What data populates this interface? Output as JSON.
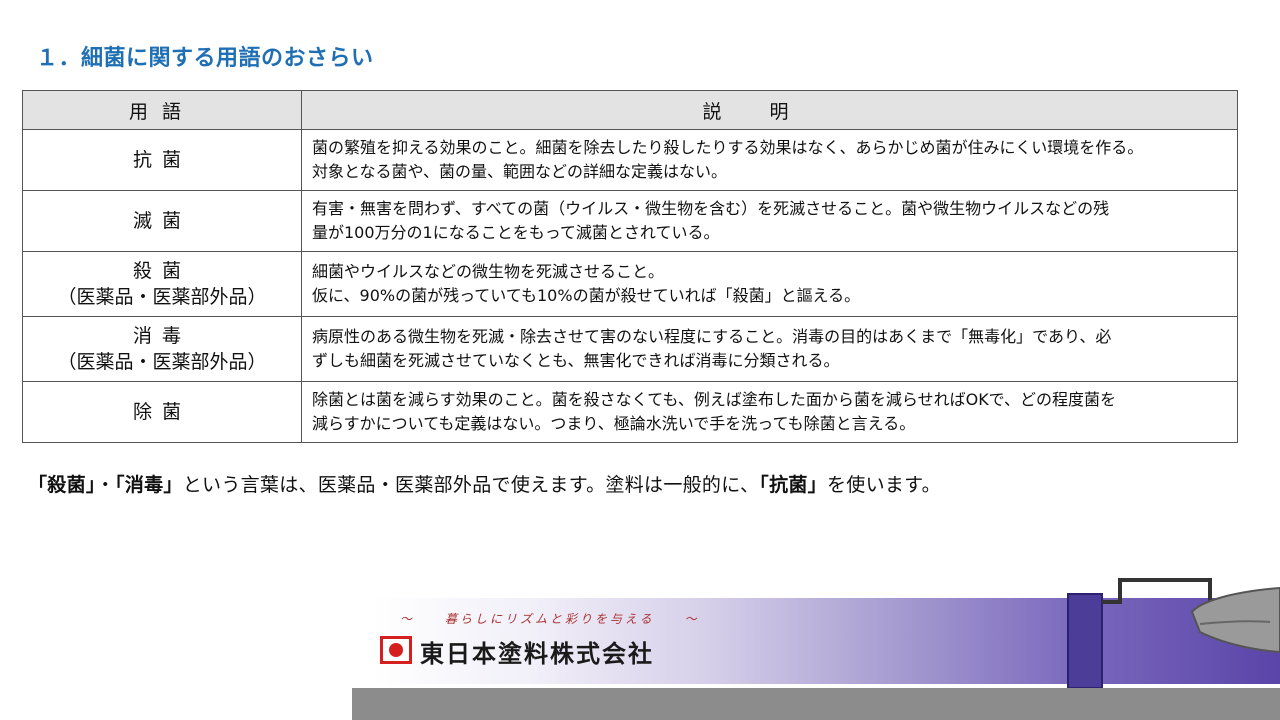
{
  "title": "１．細菌に関する用語のおさらい",
  "table": {
    "headers": {
      "term": "用語",
      "description": "説明"
    },
    "rows": [
      {
        "term": "抗菌",
        "term_sub": "",
        "desc": [
          "菌の繁殖を抑える効果のこと。細菌を除去したり殺したりする効果はなく、あらかじめ菌が住みにくい環境を作る。",
          "対象となる菌や、菌の量、範囲などの詳細な定義はない。"
        ]
      },
      {
        "term": "滅菌",
        "term_sub": "",
        "desc": [
          "有害・無害を問わず、すべての菌（ウイルス・微生物を含む）を死滅させること。菌や微生物ウイルスなどの残",
          "量が100万分の1になることをもって滅菌とされている。"
        ]
      },
      {
        "term": "殺菌",
        "term_sub": "（医薬品・医薬部外品）",
        "desc": [
          "細菌やウイルスなどの微生物を死滅させること。",
          "仮に、90%の菌が残っていても10%の菌が殺せていれば「殺菌」と謳える。"
        ]
      },
      {
        "term": "消毒",
        "term_sub": "（医薬品・医薬部外品）",
        "desc": [
          "病原性のある微生物を死滅・除去させて害のない程度にすること。消毒の目的はあくまで「無毒化」であり、必",
          "ずしも細菌を死滅させていなくとも、無害化できれば消毒に分類される。"
        ]
      },
      {
        "term": "除菌",
        "term_sub": "",
        "desc": [
          "除菌とは菌を減らす効果のこと。菌を殺さなくても、例えば塗布した面から菌を減らせればOKで、どの程度菌を",
          "減らすかについても定義はない。つまり、極論水洗いで手を洗っても除菌と言える。"
        ]
      }
    ]
  },
  "note": {
    "b1": "「殺菌」",
    "sep": "・",
    "b2": "「消毒」",
    "t1": "という言葉は、医薬品・医薬部外品で使えます。塗料は一般的に、",
    "b3": "「抗菌」",
    "t2": "を使います。"
  },
  "footer": {
    "slogan": "～　　暮らしにリズムと彩りを与える　　～",
    "company": "東日本塗料株式会社"
  }
}
